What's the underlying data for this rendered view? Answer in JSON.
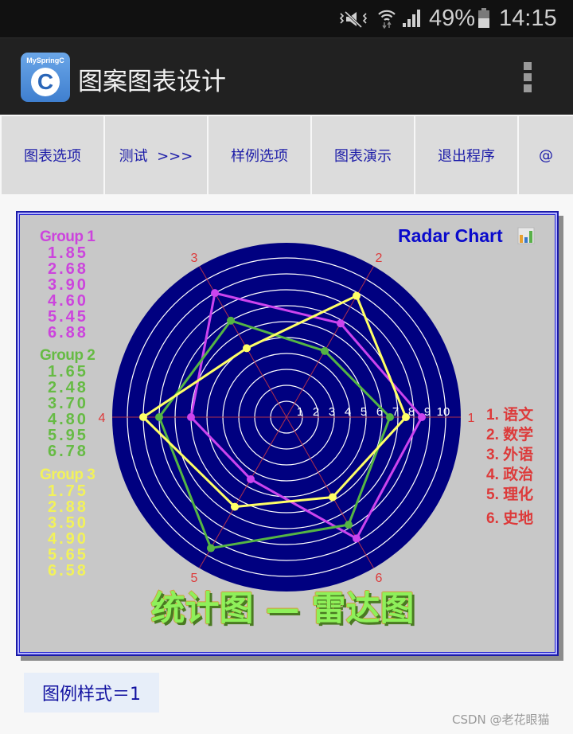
{
  "status_bar": {
    "icons": [
      "mute-vibrate-icon",
      "wifi-icon",
      "signal-icon",
      "battery-icon"
    ],
    "battery_percent": "49%",
    "time": "14:15"
  },
  "app_bar": {
    "app_icon_label": "MySpringC",
    "app_icon_letter": "C",
    "title": "图案图表设计",
    "menu_icon": "overflow-menu-icon"
  },
  "tabs": [
    {
      "label": "图表选项"
    },
    {
      "label": "测试  >>>"
    },
    {
      "label": "样例选项"
    },
    {
      "label": "图表演示"
    },
    {
      "label": "退出程序"
    },
    {
      "label": "@"
    }
  ],
  "chart_panel": {
    "header": "Radar Chart",
    "header_icon": "bar-chart-icon",
    "footer_title": "统计图 — 雷达图"
  },
  "chart_data": {
    "type": "radar",
    "title": "Radar Chart",
    "subtitle": "统计图 — 雷达图",
    "range": [
      0,
      10
    ],
    "ring_ticks": [
      "1",
      "2",
      "3",
      "4",
      "5",
      "6",
      "7",
      "8",
      "9",
      "10"
    ],
    "axes": [
      {
        "number": "1",
        "category": "语文",
        "label": "1. 语文"
      },
      {
        "number": "2",
        "category": "数学",
        "label": "2. 数学"
      },
      {
        "number": "3",
        "category": "外语",
        "label": "3. 外语"
      },
      {
        "number": "4",
        "category": "政治",
        "label": "4. 政治"
      },
      {
        "number": "5",
        "category": "理化",
        "label": "5. 理化"
      },
      {
        "number": "6",
        "category": "史地",
        "label": "6. 史地"
      }
    ],
    "categories": [
      "语文",
      "数学",
      "外语",
      "政治",
      "理化",
      "史地"
    ],
    "series": [
      {
        "name": "Group 1",
        "color": "#cc44ee",
        "legend_color": "#cc44dd",
        "values": [
          8.5,
          6.8,
          9.0,
          6.0,
          4.5,
          8.8
        ],
        "legend": [
          "1.85",
          "2.68",
          "3.90",
          "4.60",
          "5.45",
          "6.88"
        ]
      },
      {
        "name": "Group 2",
        "color": "#55b544",
        "legend_color": "#66bb44",
        "values": [
          6.5,
          4.8,
          7.0,
          8.0,
          9.5,
          7.8
        ],
        "legend": [
          "1.65",
          "2.48",
          "3.70",
          "4.80",
          "5.95",
          "6.78"
        ]
      },
      {
        "name": "Group 3",
        "color": "#ffff66",
        "legend_color": "#f2f25a",
        "values": [
          7.5,
          8.8,
          5.0,
          9.0,
          6.5,
          5.8
        ],
        "legend": [
          "1.75",
          "2.88",
          "3.50",
          "4.90",
          "5.65",
          "6.58"
        ]
      }
    ],
    "colors": {
      "disk": "#000080",
      "rings": "#ffffff",
      "axis_lines": "#b0304a",
      "axis_numbers": "#dd3a3a",
      "ring_labels": "#ffffff"
    }
  },
  "legend_button": "图例样式＝1",
  "watermark": "CSDN @老花眼猫"
}
